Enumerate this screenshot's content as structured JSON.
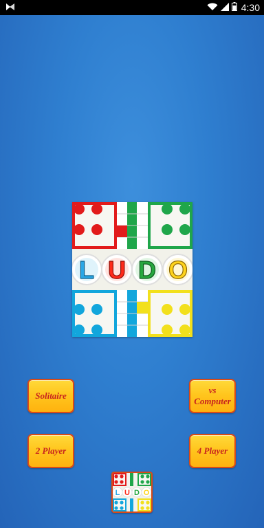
{
  "status_bar": {
    "time": "4:30",
    "icons": [
      "notification-icon",
      "wifi-icon",
      "signal-icon",
      "battery-icon"
    ]
  },
  "logo": {
    "text": "LUDO",
    "letter_colors": [
      "#2aa7e6",
      "#ff2a1a",
      "#27a83f",
      "#ffd41c"
    ]
  },
  "buttons": {
    "solitaire": "Solitaire",
    "vs_computer_line1": "vs",
    "vs_computer_line2": "Computer",
    "two_player": "2 Player",
    "four_player": "4 Player"
  },
  "colors": {
    "background": "#2f7fd0",
    "button_fill": "#ffc61e",
    "button_border": "#d94a17",
    "button_text": "#c8231e",
    "ludo_red": "#e21b1b",
    "ludo_green": "#1fa64a",
    "ludo_blue": "#12a6dc",
    "ludo_yellow": "#f2e01c"
  }
}
